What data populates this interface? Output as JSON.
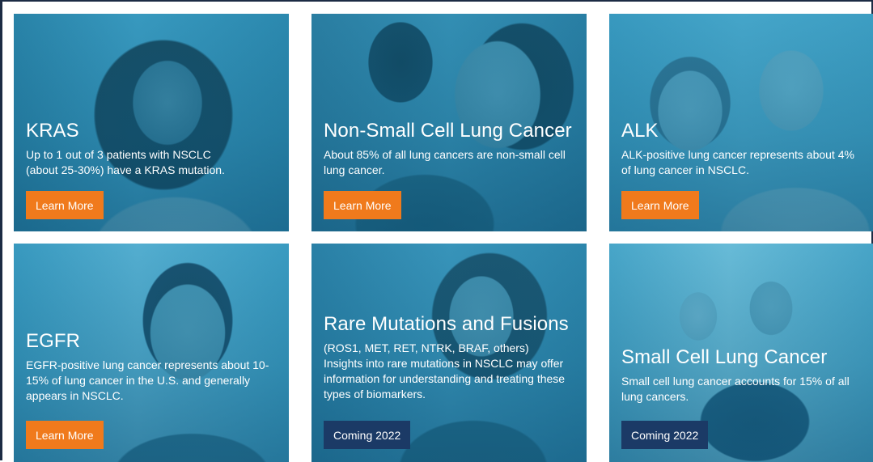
{
  "colors": {
    "frame": "#1c2b44",
    "teal_tint": "#2f8fb0",
    "cta_orange": "#f07a1c",
    "coming_navy": "#1b3a66"
  },
  "cards": [
    {
      "title": "KRAS",
      "description": "Up to 1 out of 3 patients with NSCLC (about 25-30%) have a KRAS mutation.",
      "button": "Learn More"
    },
    {
      "title": "Non-Small Cell Lung Cancer",
      "description": "About 85% of all lung cancers are non-small cell lung cancer.",
      "button": "Learn More"
    },
    {
      "title": "ALK",
      "description": "ALK-positive lung cancer represents about 4% of lung cancer in NSCLC.",
      "button": "Learn More"
    },
    {
      "title": "EGFR",
      "description": "EGFR-positive lung cancer represents about 10-15% of lung cancer in the U.S. and generally appears in NSCLC.",
      "button": "Learn More"
    },
    {
      "title": "Rare Mutations and Fusions",
      "description": "(ROS1, MET, RET, NTRK, BRAF, others) Insights into rare mutations in NSCLC may offer information for understanding and treating these types of biomarkers.",
      "button": "Coming 2022"
    },
    {
      "title": "Small Cell Lung Cancer",
      "description": "Small cell lung cancer accounts for 15% of all lung cancers.",
      "button": "Coming 2022"
    }
  ]
}
